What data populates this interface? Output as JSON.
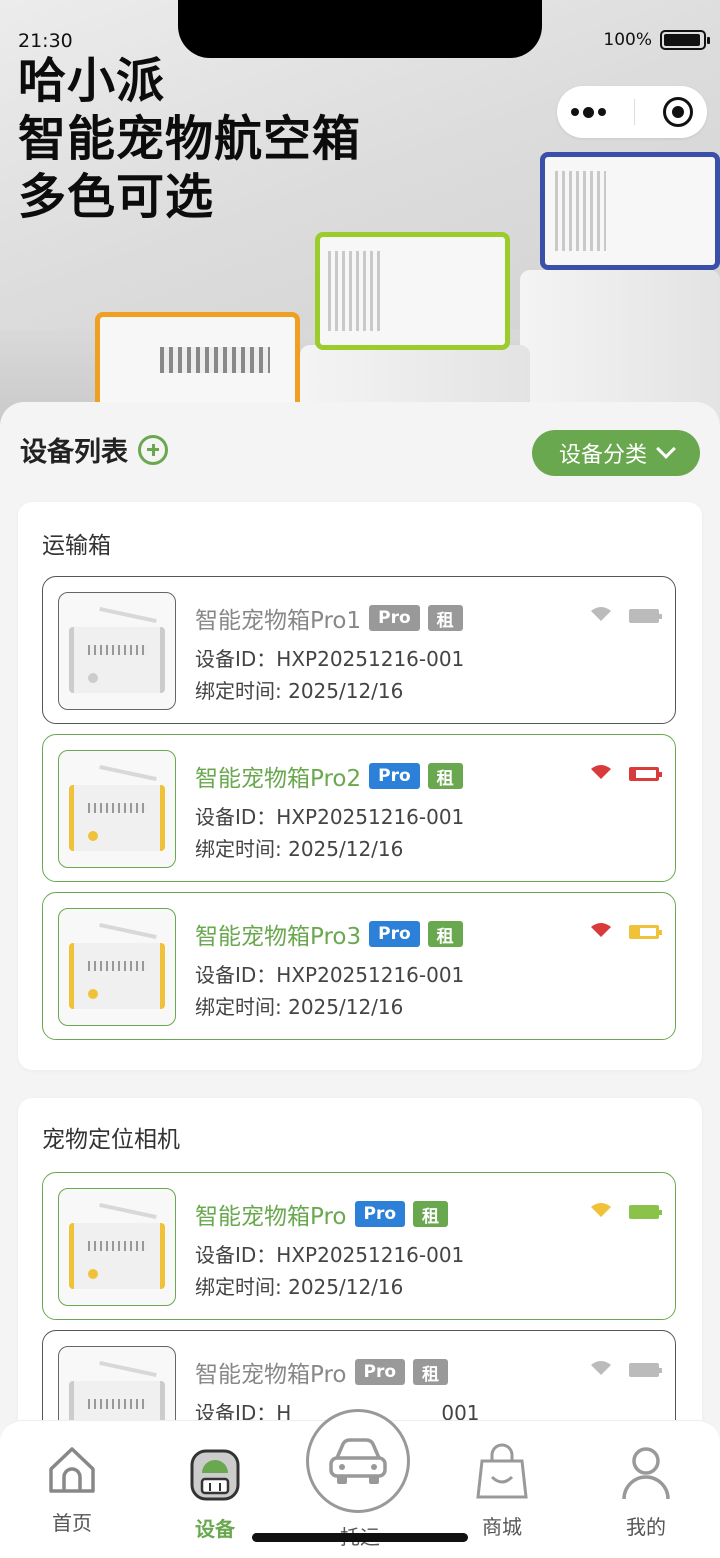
{
  "status": {
    "time": "21:30",
    "battery": "100%"
  },
  "hero": {
    "line1": "哈小派",
    "line2": "智能宠物航空箱",
    "line3": "多色可选"
  },
  "capsule": {
    "more_icon": "more-dots-icon",
    "close_icon": "target-icon"
  },
  "list": {
    "title": "设备列表",
    "category_label": "设备分类"
  },
  "groups": [
    {
      "title": "运输箱",
      "devices": [
        {
          "name": "智能宠物箱Pro1",
          "pro": "Pro",
          "rent": "租",
          "id": "设备ID：HXP20251216-001",
          "bind": "绑定时间: 2025/12/16",
          "online": false,
          "signal_color": "#bbbbbb",
          "battery_color": "#bbbbbb",
          "battery_level": 1.0
        },
        {
          "name": "智能宠物箱Pro2",
          "pro": "Pro",
          "rent": "租",
          "id": "设备ID：HXP20251216-001",
          "bind": "绑定时间: 2025/12/16",
          "online": true,
          "signal_color": "#d93a3a",
          "battery_color": "#d93a3a",
          "battery_level": 0.15
        },
        {
          "name": "智能宠物箱Pro3",
          "pro": "Pro",
          "rent": "租",
          "id": "设备ID：HXP20251216-001",
          "bind": "绑定时间: 2025/12/16",
          "online": true,
          "signal_color": "#d93a3a",
          "battery_color": "#f0c23a",
          "battery_level": 0.35
        }
      ]
    },
    {
      "title": "宠物定位相机",
      "devices": [
        {
          "name": "智能宠物箱Pro",
          "pro": "Pro",
          "rent": "租",
          "id": "设备ID：HXP20251216-001",
          "bind": "绑定时间: 2025/12/16",
          "online": true,
          "signal_color": "#f0c23a",
          "battery_color": "#8bc34a",
          "battery_level": 1.0
        },
        {
          "name": "智能宠物箱Pro",
          "pro": "Pro",
          "rent": "租",
          "id": "设备ID：H",
          "id_tail": "001",
          "online": false,
          "signal_color": "#bbbbbb",
          "battery_color": "#bbbbbb",
          "battery_level": 1.0
        }
      ]
    }
  ],
  "tabs": [
    {
      "label": "首页",
      "icon": "home-icon"
    },
    {
      "label": "设备",
      "icon": "backpack-icon",
      "active": true
    },
    {
      "label": "托运",
      "icon": "car-icon"
    },
    {
      "label": "商城",
      "icon": "shopping-bag-icon"
    },
    {
      "label": "我的",
      "icon": "user-icon"
    }
  ],
  "colors": {
    "accent": "#6aa84f",
    "pro_blue": "#2d80d8",
    "inactive_gray": "#999999"
  }
}
